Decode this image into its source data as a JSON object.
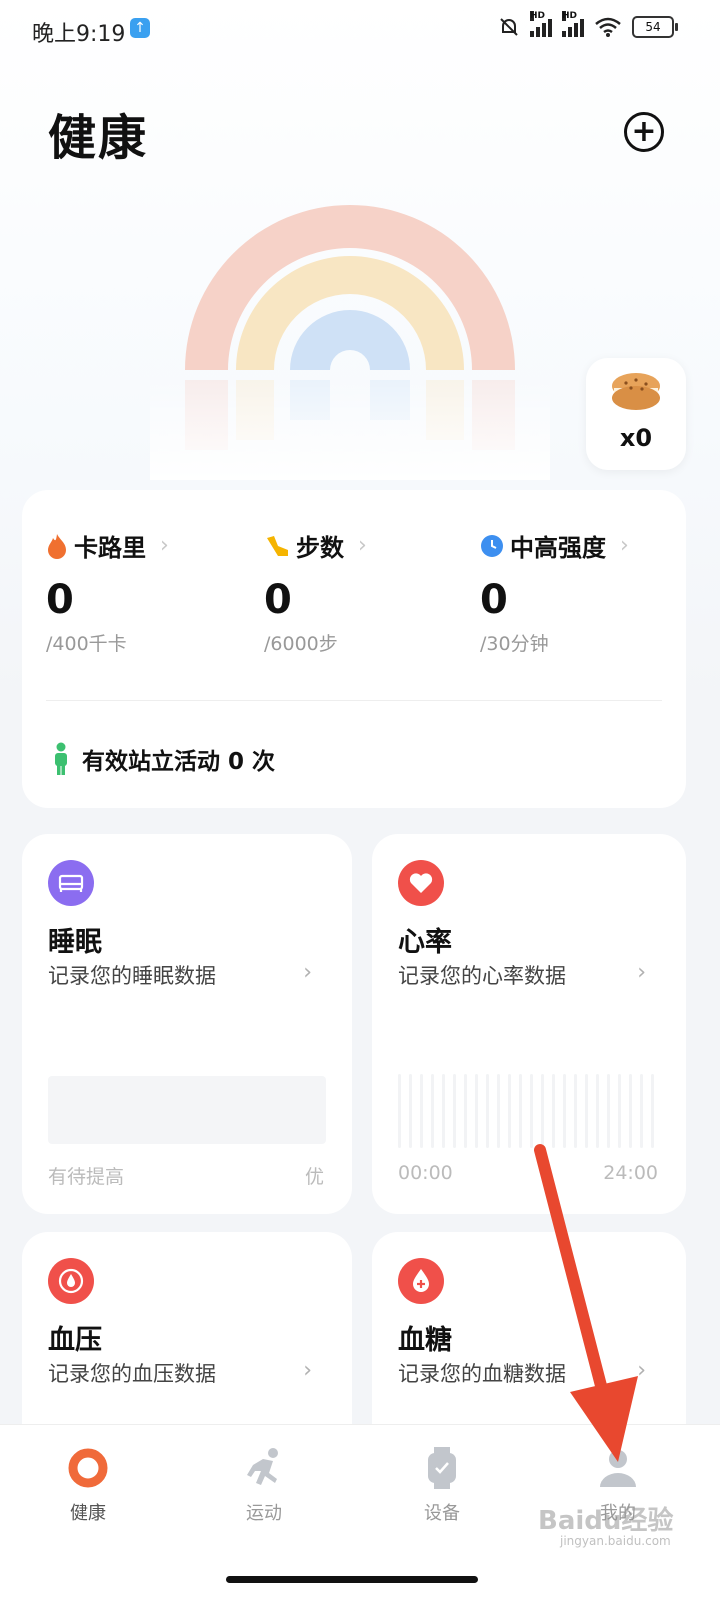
{
  "status_bar": {
    "time": "晚上9:19",
    "battery": "54",
    "hd1": "HD",
    "hd2": "HD"
  },
  "header": {
    "title": "健康",
    "add_icon": "plus-circle-icon"
  },
  "reward": {
    "count": "x0",
    "icon": "cookie-icon"
  },
  "activity": {
    "metrics": [
      {
        "label": "卡路里",
        "value": "0",
        "goal": "/400千卡",
        "icon": "flame-icon",
        "color": "#f07030"
      },
      {
        "label": "步数",
        "value": "0",
        "goal": "/6000步",
        "icon": "shoe-icon",
        "color": "#f5b400"
      },
      {
        "label": "中高强度",
        "value": "0",
        "goal": "/30分钟",
        "icon": "clock-icon",
        "color": "#3d8ff0"
      }
    ],
    "stand_text": "有效站立活动 0 次"
  },
  "tiles": {
    "sleep": {
      "title": "睡眠",
      "sub": "记录您的睡眠数据",
      "foot_left": "有待提高",
      "foot_right": "优",
      "color": "#8b6df0"
    },
    "heart": {
      "title": "心率",
      "sub": "记录您的心率数据",
      "foot_left": "00:00",
      "foot_right": "24:00",
      "color": "#f0504a"
    },
    "bp": {
      "title": "血压",
      "sub": "记录您的血压数据",
      "color": "#f0504a"
    },
    "glucose": {
      "title": "血糖",
      "sub": "记录您的血糖数据",
      "color": "#f0504a"
    }
  },
  "nav": {
    "items": [
      {
        "label": "健康",
        "icon": "ring-icon",
        "active": true
      },
      {
        "label": "运动",
        "icon": "runner-icon"
      },
      {
        "label": "设备",
        "icon": "watch-icon"
      },
      {
        "label": "我的",
        "icon": "person-icon"
      }
    ]
  },
  "watermark": {
    "text": "Baidu经验",
    "sub": "jingyan.baidu.com"
  }
}
